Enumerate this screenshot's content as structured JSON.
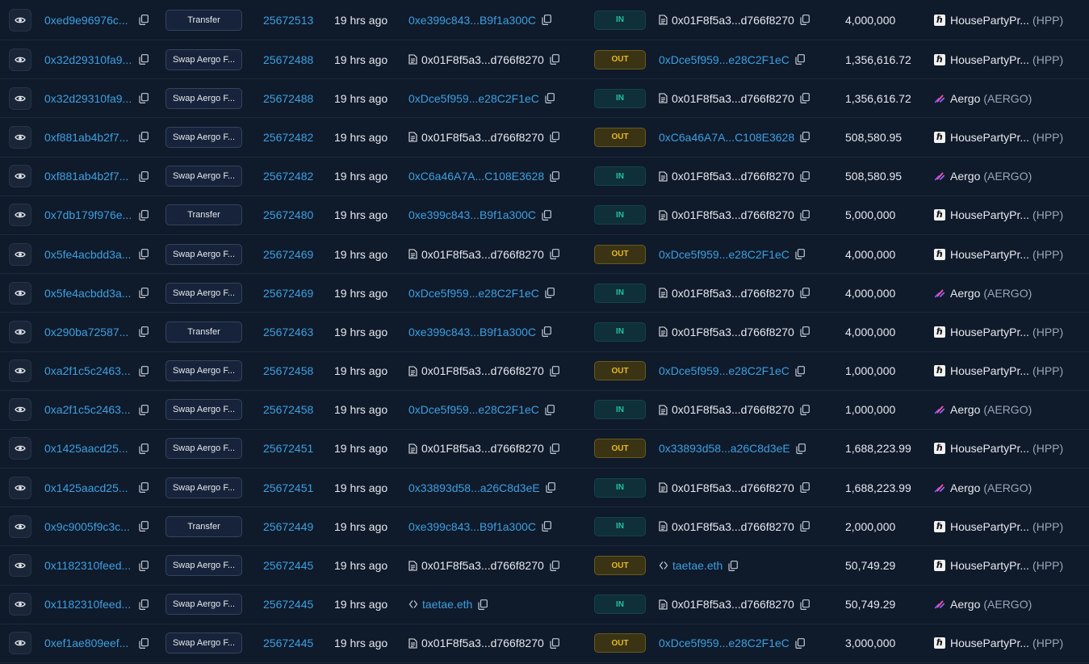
{
  "rows": [
    {
      "hash": "0xed9e96976c...",
      "method": "Transfer",
      "block": "25672513",
      "age": "19 hrs ago",
      "from": {
        "text": "0xe399c843...B9f1a300C",
        "kind": "link"
      },
      "dir": "IN",
      "to": {
        "text": "0x01F8f5a3...d766f8270",
        "kind": "contract"
      },
      "amount": "4,000,000",
      "token": {
        "name": "HousePartyPr...",
        "symbol": "(HPP)",
        "icon": "hpp-icon"
      }
    },
    {
      "hash": "0x32d29310fa9...",
      "method": "Swap Aergo F...",
      "block": "25672488",
      "age": "19 hrs ago",
      "from": {
        "text": "0x01F8f5a3...d766f8270",
        "kind": "contract"
      },
      "dir": "OUT",
      "to": {
        "text": "0xDce5f959...e28C2F1eC",
        "kind": "link"
      },
      "amount": "1,356,616.72",
      "token": {
        "name": "HousePartyPr...",
        "symbol": "(HPP)",
        "icon": "hpp-icon"
      }
    },
    {
      "hash": "0x32d29310fa9...",
      "method": "Swap Aergo F...",
      "block": "25672488",
      "age": "19 hrs ago",
      "from": {
        "text": "0xDce5f959...e28C2F1eC",
        "kind": "link"
      },
      "dir": "IN",
      "to": {
        "text": "0x01F8f5a3...d766f8270",
        "kind": "contract"
      },
      "amount": "1,356,616.72",
      "token": {
        "name": "Aergo",
        "symbol": "(AERGO)",
        "icon": "aergo-icon"
      }
    },
    {
      "hash": "0xf881ab4b2f7...",
      "method": "Swap Aergo F...",
      "block": "25672482",
      "age": "19 hrs ago",
      "from": {
        "text": "0x01F8f5a3...d766f8270",
        "kind": "contract"
      },
      "dir": "OUT",
      "to": {
        "text": "0xC6a46A7A...C108E3628",
        "kind": "link"
      },
      "amount": "508,580.95",
      "token": {
        "name": "HousePartyPr...",
        "symbol": "(HPP)",
        "icon": "hpp-icon"
      }
    },
    {
      "hash": "0xf881ab4b2f7...",
      "method": "Swap Aergo F...",
      "block": "25672482",
      "age": "19 hrs ago",
      "from": {
        "text": "0xC6a46A7A...C108E3628",
        "kind": "link"
      },
      "dir": "IN",
      "to": {
        "text": "0x01F8f5a3...d766f8270",
        "kind": "contract"
      },
      "amount": "508,580.95",
      "token": {
        "name": "Aergo",
        "symbol": "(AERGO)",
        "icon": "aergo-icon"
      }
    },
    {
      "hash": "0x7db179f976e...",
      "method": "Transfer",
      "block": "25672480",
      "age": "19 hrs ago",
      "from": {
        "text": "0xe399c843...B9f1a300C",
        "kind": "link"
      },
      "dir": "IN",
      "to": {
        "text": "0x01F8f5a3...d766f8270",
        "kind": "contract"
      },
      "amount": "5,000,000",
      "token": {
        "name": "HousePartyPr...",
        "symbol": "(HPP)",
        "icon": "hpp-icon"
      }
    },
    {
      "hash": "0x5fe4acbdd3a...",
      "method": "Swap Aergo F...",
      "block": "25672469",
      "age": "19 hrs ago",
      "from": {
        "text": "0x01F8f5a3...d766f8270",
        "kind": "contract"
      },
      "dir": "OUT",
      "to": {
        "text": "0xDce5f959...e28C2F1eC",
        "kind": "link"
      },
      "amount": "4,000,000",
      "token": {
        "name": "HousePartyPr...",
        "symbol": "(HPP)",
        "icon": "hpp-icon"
      }
    },
    {
      "hash": "0x5fe4acbdd3a...",
      "method": "Swap Aergo F...",
      "block": "25672469",
      "age": "19 hrs ago",
      "from": {
        "text": "0xDce5f959...e28C2F1eC",
        "kind": "link"
      },
      "dir": "IN",
      "to": {
        "text": "0x01F8f5a3...d766f8270",
        "kind": "contract"
      },
      "amount": "4,000,000",
      "token": {
        "name": "Aergo",
        "symbol": "(AERGO)",
        "icon": "aergo-icon"
      }
    },
    {
      "hash": "0x290ba72587...",
      "method": "Transfer",
      "block": "25672463",
      "age": "19 hrs ago",
      "from": {
        "text": "0xe399c843...B9f1a300C",
        "kind": "link"
      },
      "dir": "IN",
      "to": {
        "text": "0x01F8f5a3...d766f8270",
        "kind": "contract"
      },
      "amount": "4,000,000",
      "token": {
        "name": "HousePartyPr...",
        "symbol": "(HPP)",
        "icon": "hpp-icon"
      }
    },
    {
      "hash": "0xa2f1c5c2463...",
      "method": "Swap Aergo F...",
      "block": "25672458",
      "age": "19 hrs ago",
      "from": {
        "text": "0x01F8f5a3...d766f8270",
        "kind": "contract"
      },
      "dir": "OUT",
      "to": {
        "text": "0xDce5f959...e28C2F1eC",
        "kind": "link"
      },
      "amount": "1,000,000",
      "token": {
        "name": "HousePartyPr...",
        "symbol": "(HPP)",
        "icon": "hpp-icon"
      }
    },
    {
      "hash": "0xa2f1c5c2463...",
      "method": "Swap Aergo F...",
      "block": "25672458",
      "age": "19 hrs ago",
      "from": {
        "text": "0xDce5f959...e28C2F1eC",
        "kind": "link"
      },
      "dir": "IN",
      "to": {
        "text": "0x01F8f5a3...d766f8270",
        "kind": "contract"
      },
      "amount": "1,000,000",
      "token": {
        "name": "Aergo",
        "symbol": "(AERGO)",
        "icon": "aergo-icon"
      }
    },
    {
      "hash": "0x1425aacd25...",
      "method": "Swap Aergo F...",
      "block": "25672451",
      "age": "19 hrs ago",
      "from": {
        "text": "0x01F8f5a3...d766f8270",
        "kind": "contract"
      },
      "dir": "OUT",
      "to": {
        "text": "0x33893d58...a26C8d3eE",
        "kind": "link"
      },
      "amount": "1,688,223.99",
      "token": {
        "name": "HousePartyPr...",
        "symbol": "(HPP)",
        "icon": "hpp-icon"
      }
    },
    {
      "hash": "0x1425aacd25...",
      "method": "Swap Aergo F...",
      "block": "25672451",
      "age": "19 hrs ago",
      "from": {
        "text": "0x33893d58...a26C8d3eE",
        "kind": "link"
      },
      "dir": "IN",
      "to": {
        "text": "0x01F8f5a3...d766f8270",
        "kind": "contract"
      },
      "amount": "1,688,223.99",
      "token": {
        "name": "Aergo",
        "symbol": "(AERGO)",
        "icon": "aergo-icon"
      }
    },
    {
      "hash": "0x9c9005f9c3c...",
      "method": "Transfer",
      "block": "25672449",
      "age": "19 hrs ago",
      "from": {
        "text": "0xe399c843...B9f1a300C",
        "kind": "link"
      },
      "dir": "IN",
      "to": {
        "text": "0x01F8f5a3...d766f8270",
        "kind": "contract"
      },
      "amount": "2,000,000",
      "token": {
        "name": "HousePartyPr...",
        "symbol": "(HPP)",
        "icon": "hpp-icon"
      }
    },
    {
      "hash": "0x1182310feed...",
      "method": "Swap Aergo F...",
      "block": "25672445",
      "age": "19 hrs ago",
      "from": {
        "text": "0x01F8f5a3...d766f8270",
        "kind": "contract"
      },
      "dir": "OUT",
      "to": {
        "text": "taetae.eth",
        "kind": "ens"
      },
      "amount": "50,749.29",
      "token": {
        "name": "HousePartyPr...",
        "symbol": "(HPP)",
        "icon": "hpp-icon"
      }
    },
    {
      "hash": "0x1182310feed...",
      "method": "Swap Aergo F...",
      "block": "25672445",
      "age": "19 hrs ago",
      "from": {
        "text": "taetae.eth",
        "kind": "ens"
      },
      "dir": "IN",
      "to": {
        "text": "0x01F8f5a3...d766f8270",
        "kind": "contract"
      },
      "amount": "50,749.29",
      "token": {
        "name": "Aergo",
        "symbol": "(AERGO)",
        "icon": "aergo-icon"
      }
    },
    {
      "hash": "0xef1ae809eef...",
      "method": "Swap Aergo F...",
      "block": "25672445",
      "age": "19 hrs ago",
      "from": {
        "text": "0x01F8f5a3...d766f8270",
        "kind": "contract"
      },
      "dir": "OUT",
      "to": {
        "text": "0xDce5f959...e28C2F1eC",
        "kind": "link"
      },
      "amount": "3,000,000",
      "token": {
        "name": "HousePartyPr...",
        "symbol": "(HPP)",
        "icon": "hpp-icon"
      }
    }
  ],
  "colors": {
    "link": "#3ea0e0",
    "in": "#22c3a0",
    "out": "#e9b824",
    "background": "#0f1a2b"
  }
}
